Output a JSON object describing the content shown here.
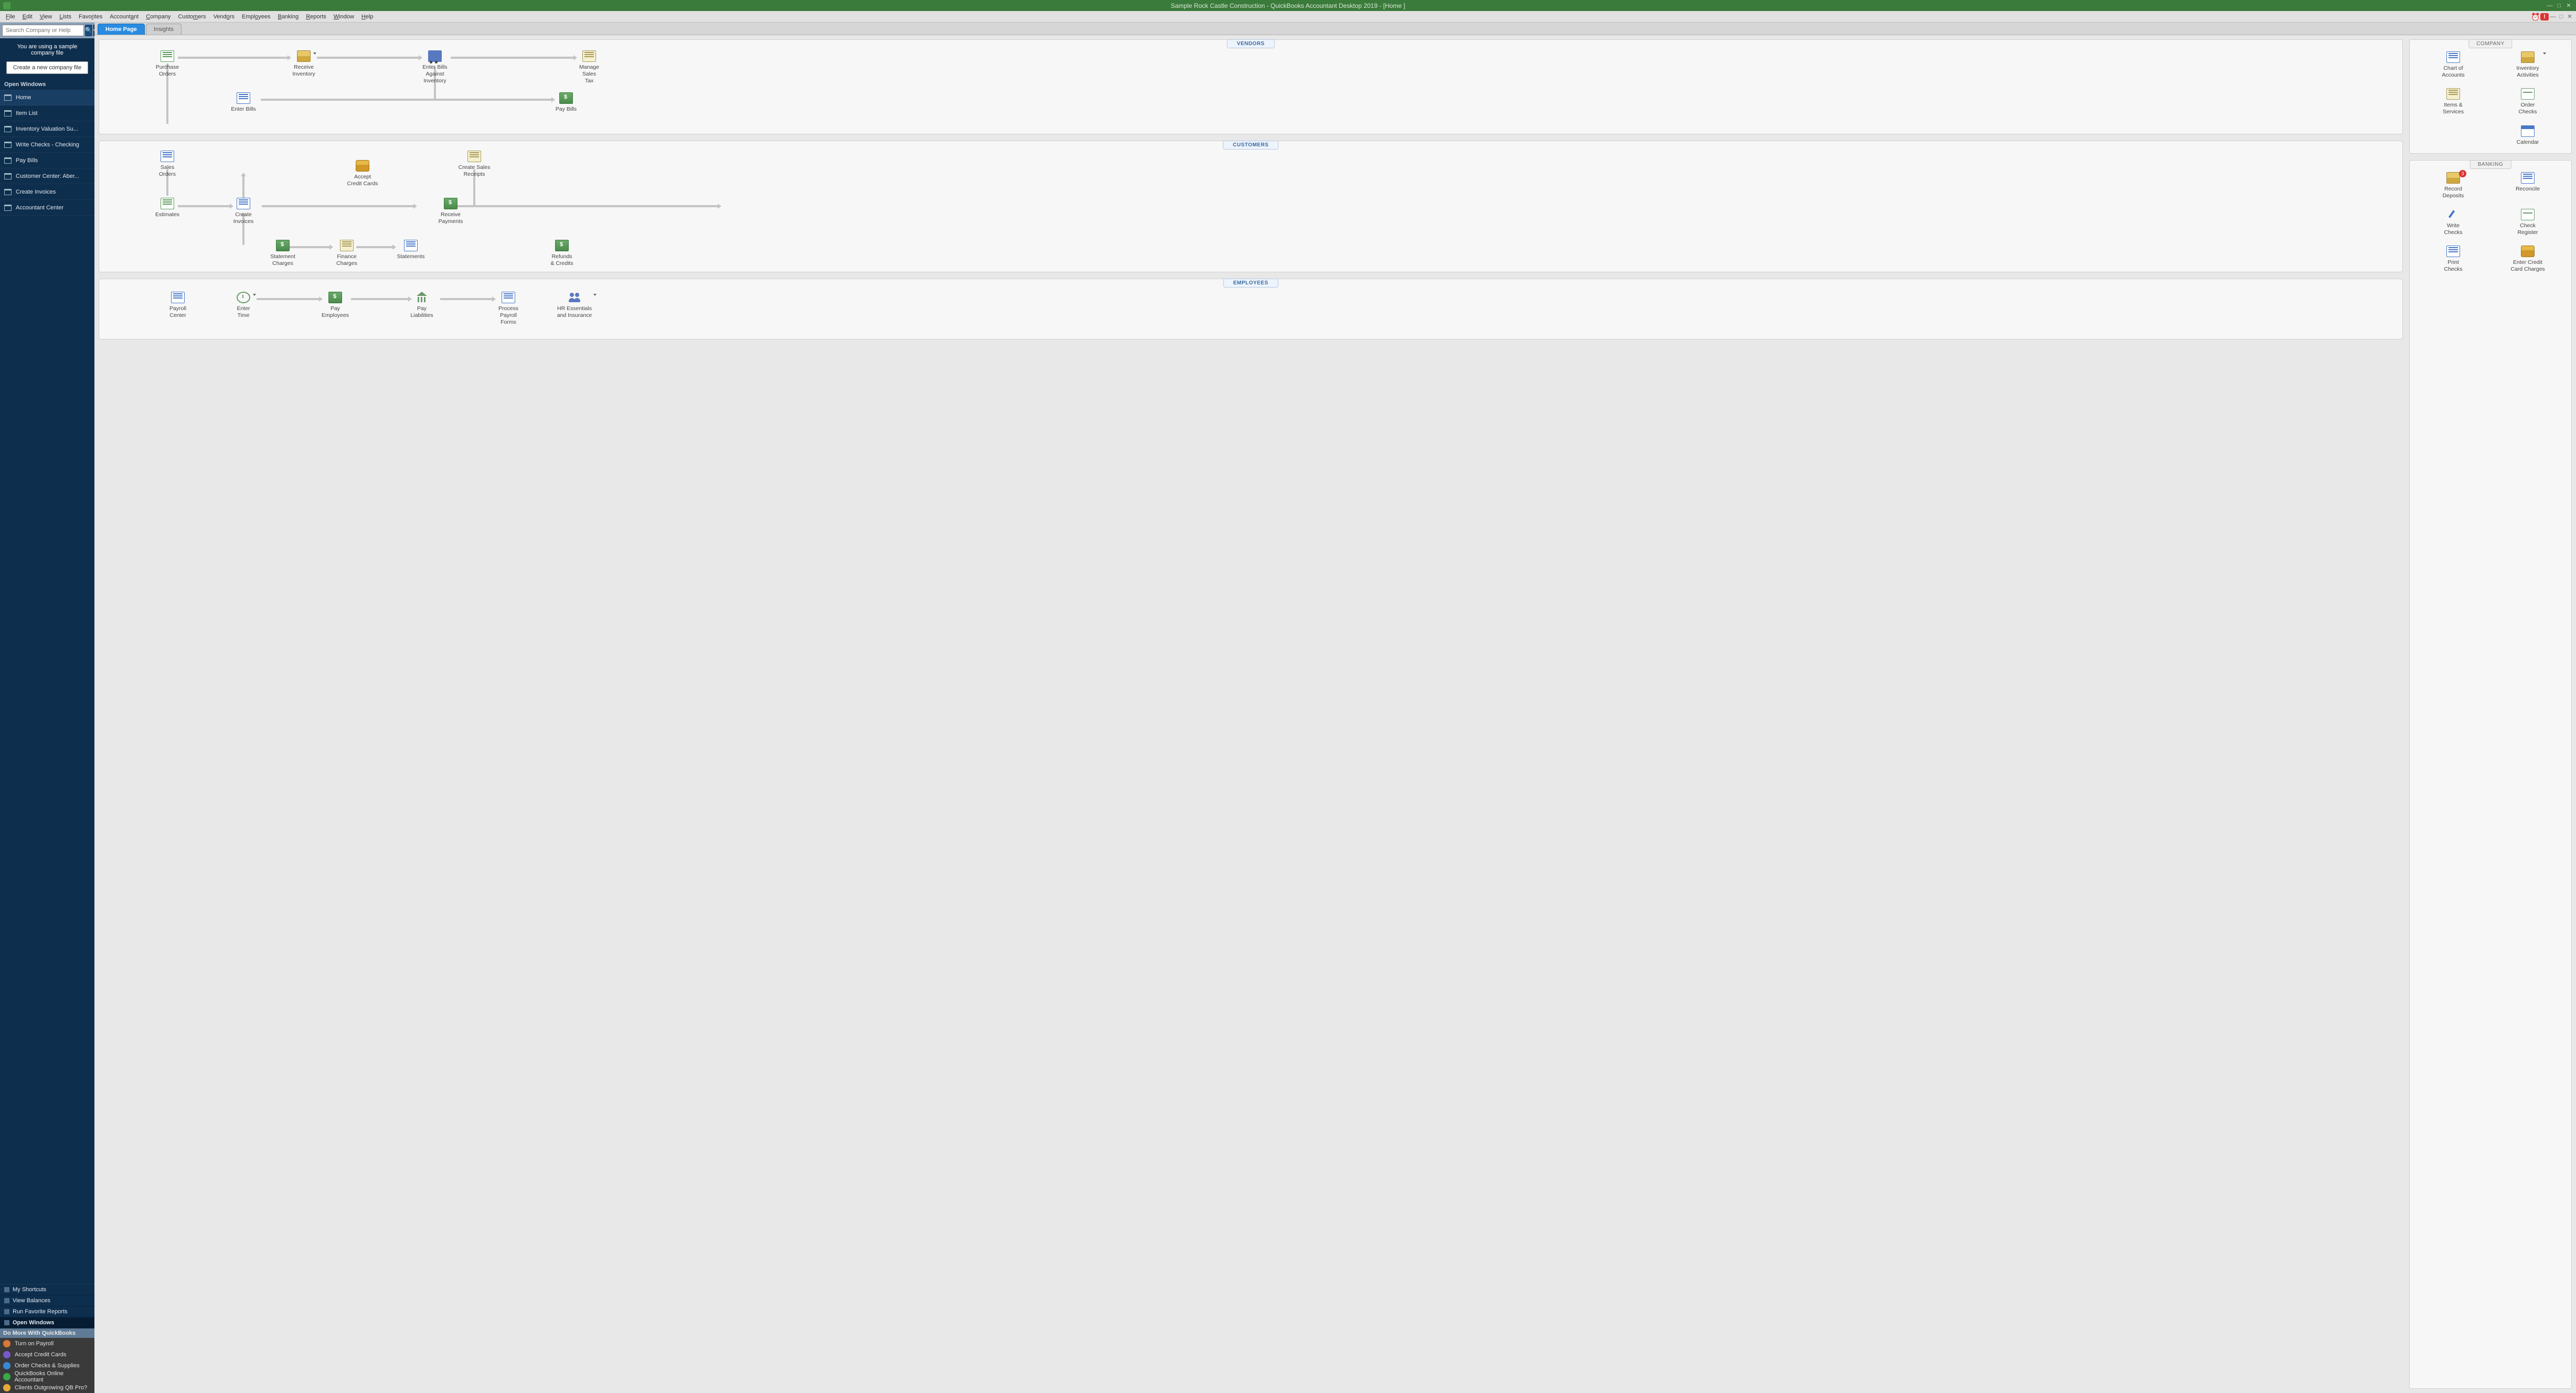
{
  "title": "Sample Rock Castle Construction  - QuickBooks Accountant Desktop 2019 - [Home ]",
  "menubar": [
    "File",
    "Edit",
    "View",
    "Lists",
    "Favorites",
    "Accountant",
    "Company",
    "Customers",
    "Vendors",
    "Employees",
    "Banking",
    "Reports",
    "Window",
    "Help"
  ],
  "search_placeholder": "Search Company or Help",
  "sample_msg_1": "You are using a sample",
  "sample_msg_2": "company file",
  "new_company_btn": "Create a new company file",
  "open_windows_hdr": "Open Windows",
  "open_windows": [
    "Home",
    "Item List",
    "Inventory Valuation Su...",
    "Write Checks - Checking",
    "Pay Bills",
    "Customer Center: Aber...",
    "Create Invoices",
    "Accountant Center"
  ],
  "bottom_nav": [
    "My Shortcuts",
    "View Balances",
    "Run Favorite Reports",
    "Open Windows"
  ],
  "do_more_hdr": "Do More With QuickBooks",
  "do_more": [
    "Turn on Payroll",
    "Accept Credit Cards",
    "Order Checks & Supplies",
    "QuickBooks Online Accountant",
    "Clients Outgrowing QB Pro?"
  ],
  "tabs": {
    "home": "Home Page",
    "insights": "Insights"
  },
  "section_labels": {
    "vendors": "VENDORS",
    "customers": "CUSTOMERS",
    "employees": "EMPLOYEES",
    "company": "COMPANY",
    "banking": "BANKING"
  },
  "vendors": {
    "purchase_orders": "Purchase\nOrders",
    "receive_inventory": "Receive\nInventory",
    "enter_bills_against": "Enter Bills\nAgainst\nInventory",
    "manage_sales_tax": "Manage\nSales\nTax",
    "enter_bills": "Enter Bills",
    "pay_bills": "Pay Bills"
  },
  "customers": {
    "sales_orders": "Sales\nOrders",
    "accept_cc": "Accept\nCredit Cards",
    "create_receipts": "Create Sales\nReceipts",
    "estimates": "Estimates",
    "create_invoices": "Create\nInvoices",
    "receive_payments": "Receive\nPayments",
    "statement_charges": "Statement\nCharges",
    "finance_charges": "Finance\nCharges",
    "statements": "Statements",
    "refunds": "Refunds\n& Credits"
  },
  "employees": {
    "payroll_center": "Payroll\nCenter",
    "enter_time": "Enter\nTime",
    "pay_employees": "Pay\nEmployees",
    "pay_liabilities": "Pay\nLiabilities",
    "process_forms": "Process\nPayroll\nForms",
    "hr": "HR Essentials\nand Insurance"
  },
  "company": {
    "chart": "Chart of\nAccounts",
    "inventory": "Inventory\nActivities",
    "items": "Items &\nServices",
    "order_checks": "Order\nChecks",
    "calendar": "Calendar"
  },
  "banking": {
    "record_deposits": "Record\nDeposits",
    "deposits_badge": "3",
    "reconcile": "Reconcile",
    "write_checks": "Write\nChecks",
    "check_register": "Check\nRegister",
    "print_checks": "Print\nChecks",
    "enter_cc": "Enter Credit\nCard Charges"
  }
}
